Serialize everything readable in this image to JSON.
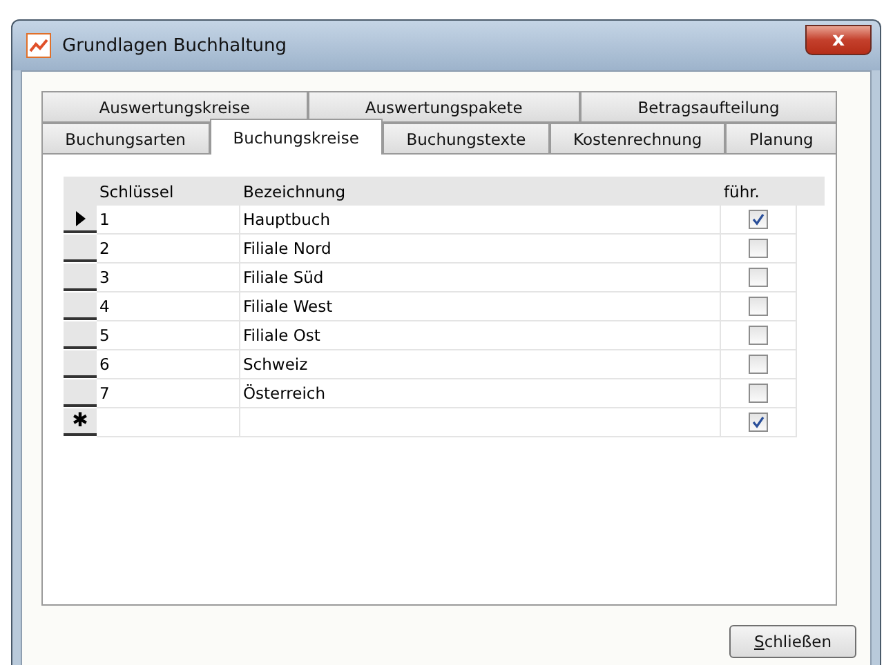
{
  "window": {
    "title": "Grundlagen Buchhaltung",
    "close_label": "x"
  },
  "tab_rows": [
    [
      {
        "label": "Auswertungskreise",
        "selected": false
      },
      {
        "label": "Auswertungspakete",
        "selected": false
      },
      {
        "label": "Betragsaufteilung",
        "selected": false
      }
    ],
    [
      {
        "label": "Buchungsarten",
        "selected": false
      },
      {
        "label": "Buchungskreise",
        "selected": true
      },
      {
        "label": "Buchungstexte",
        "selected": false
      },
      {
        "label": "Kostenrechnung",
        "selected": false
      },
      {
        "label": "Planung",
        "selected": false
      }
    ]
  ],
  "table": {
    "columns": [
      "Schlüssel",
      "Bezeichnung",
      "führ."
    ],
    "rows": [
      {
        "current": true,
        "key": "1",
        "name": "Hauptbuch",
        "checked": true
      },
      {
        "current": false,
        "key": "2",
        "name": "Filiale Nord",
        "checked": false
      },
      {
        "current": false,
        "key": "3",
        "name": "Filiale Süd",
        "checked": false
      },
      {
        "current": false,
        "key": "4",
        "name": "Filiale West",
        "checked": false
      },
      {
        "current": false,
        "key": "5",
        "name": "Filiale Ost",
        "checked": false
      },
      {
        "current": false,
        "key": "6",
        "name": "Schweiz",
        "checked": false
      },
      {
        "current": false,
        "key": "7",
        "name": "Österreich",
        "checked": false
      },
      {
        "current": false,
        "new_marker": "✱",
        "checked": true
      }
    ]
  },
  "buttons": [
    "Schließen"
  ]
}
